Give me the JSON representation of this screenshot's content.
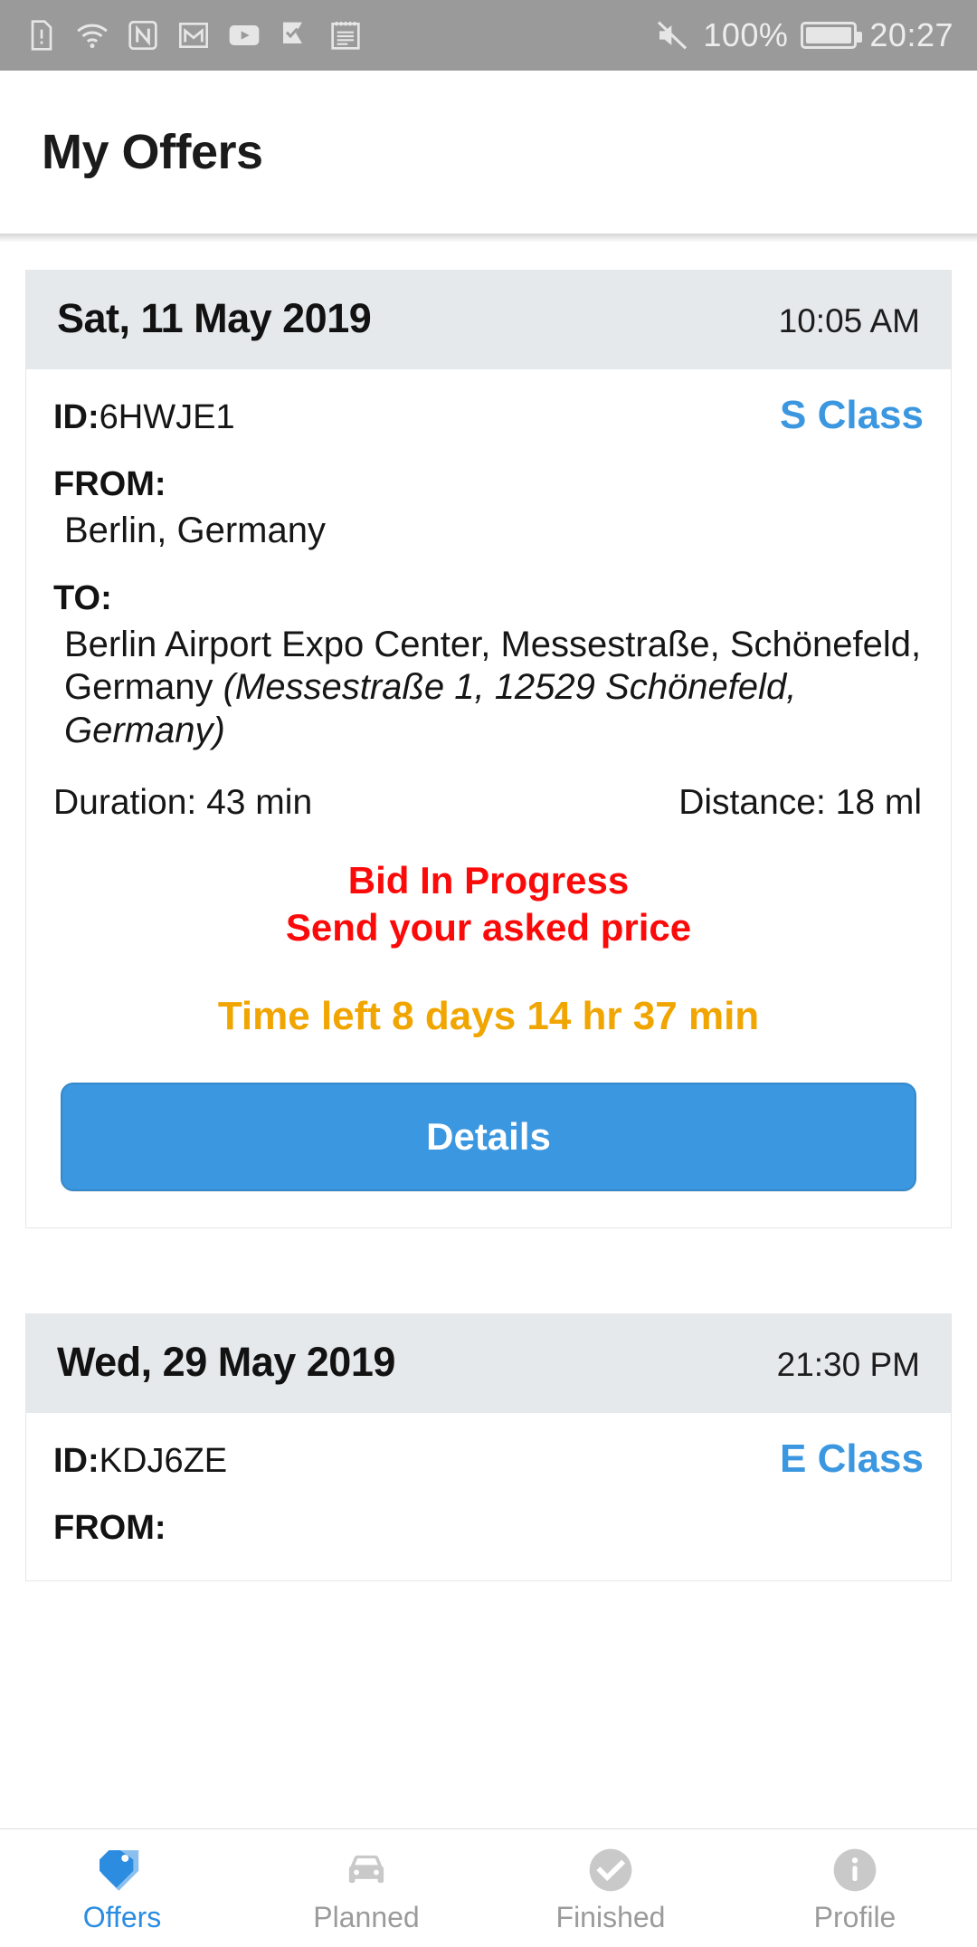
{
  "status_bar": {
    "left_icons": [
      "sim-alert-icon",
      "wifi-icon",
      "nfc-icon",
      "gmail-icon",
      "youtube-icon",
      "tick-flag-icon",
      "calendar-notes-icon"
    ],
    "mute_icon": "volume-mute-icon",
    "battery_percent": "100%",
    "battery_icon": "battery-full-icon",
    "clock": "20:27"
  },
  "app_bar": {
    "title": "My Offers"
  },
  "colors": {
    "accent_blue": "#3b97e0",
    "alert_red": "#fb0a0a",
    "countdown_amber": "#f0a500",
    "card_header_grey": "#e5e9ec",
    "status_bar_grey": "#9a9a9a",
    "inactive_grey": "#9b9b9b"
  },
  "offers": [
    {
      "date": "Sat, 11 May 2019",
      "time": "10:05 AM",
      "id_label": "ID:",
      "id_value": "6HWJE1",
      "class": "S Class",
      "from_label": "FROM:",
      "from_value": "Berlin, Germany",
      "to_label": "TO:",
      "to_value": "Berlin Airport Expo Center, Messestraße, Schönefeld, Germany ",
      "to_detail": "(Messestraße 1, 12529 Schönefeld, Germany)",
      "duration": "Duration: 43 min",
      "distance": "Distance: 18 ml",
      "status_line1": "Bid In Progress",
      "status_line2": "Send your asked price",
      "countdown": "Time left 8 days 14 hr 37 min",
      "details_button": "Details"
    },
    {
      "date": "Wed, 29 May 2019",
      "time": "21:30 PM",
      "id_label": "ID:",
      "id_value": "KDJ6ZE",
      "class": "E Class",
      "from_label": "FROM:"
    }
  ],
  "bottom_nav": {
    "items": [
      {
        "label": "Offers",
        "icon": "price-tag-icon",
        "active": true
      },
      {
        "label": "Planned",
        "icon": "car-icon",
        "active": false
      },
      {
        "label": "Finished",
        "icon": "check-circle-icon",
        "active": false
      },
      {
        "label": "Profile",
        "icon": "info-circle-icon",
        "active": false
      }
    ]
  }
}
